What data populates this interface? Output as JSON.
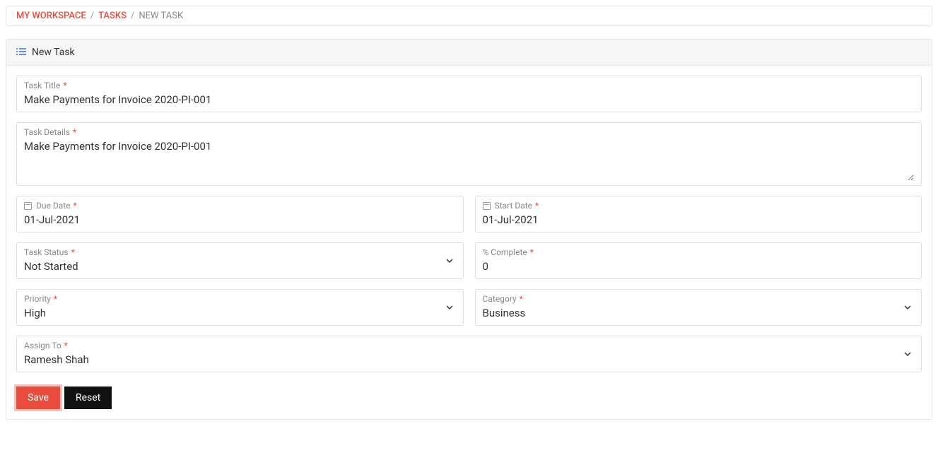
{
  "breadcrumb": {
    "item1": "MY WORKSPACE",
    "item2": "TASKS",
    "current": "NEW TASK"
  },
  "panel": {
    "title": "New Task"
  },
  "fields": {
    "taskTitle": {
      "label": "Task Title",
      "value": "Make Payments for Invoice 2020-PI-001"
    },
    "taskDetails": {
      "label": "Task Details",
      "value": "Make Payments for Invoice 2020-PI-001"
    },
    "dueDate": {
      "label": "Due Date",
      "value": "01-Jul-2021"
    },
    "startDate": {
      "label": "Start Date",
      "value": "01-Jul-2021"
    },
    "taskStatus": {
      "label": "Task Status",
      "value": "Not Started"
    },
    "percentComplete": {
      "label": "% Complete",
      "value": "0"
    },
    "priority": {
      "label": "Priority",
      "value": "High"
    },
    "category": {
      "label": "Category",
      "value": "Business"
    },
    "assignTo": {
      "label": "Assign To",
      "value": "Ramesh Shah"
    }
  },
  "actions": {
    "save": "Save",
    "reset": "Reset"
  }
}
